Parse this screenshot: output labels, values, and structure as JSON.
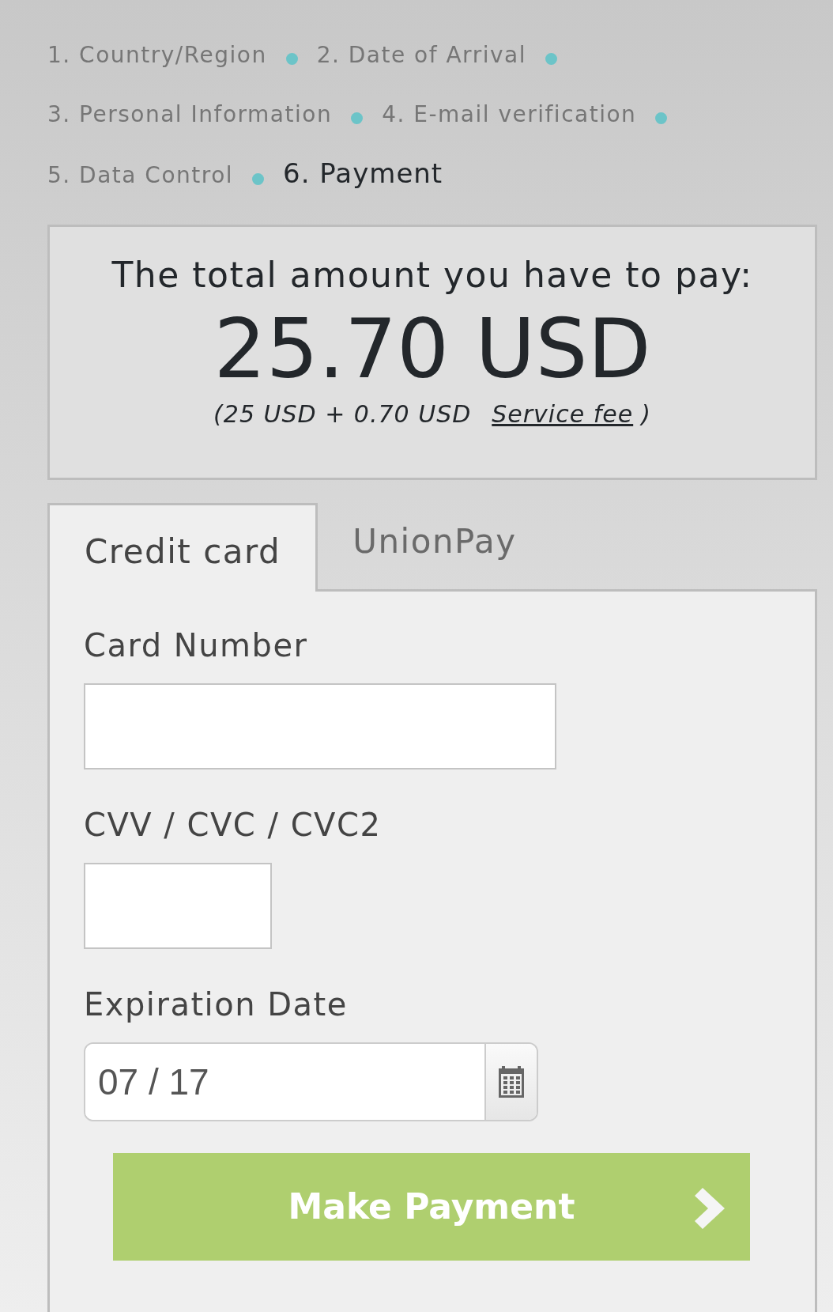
{
  "steps": [
    {
      "label": "1. Country/Region",
      "selected": false
    },
    {
      "label": "2. Date of Arrival",
      "selected": false
    },
    {
      "label": "3. Personal Information",
      "selected": false
    },
    {
      "label": "4. E-mail verification",
      "selected": false
    },
    {
      "label": "5. Data Control",
      "selected": false
    },
    {
      "label": "6. Payment",
      "selected": true
    }
  ],
  "total": {
    "heading": "The total amount you have to pay:",
    "amount": "25.70 USD",
    "breakdown": "(25 USD + 0.70 USD",
    "fee_link": "Service fee",
    "closing": ")"
  },
  "tabs": [
    {
      "label": "Credit card",
      "selected": true
    },
    {
      "label": "UnionPay",
      "selected": false
    }
  ],
  "form": {
    "fields": [
      {
        "kind": "text",
        "label": "Card Number"
      },
      {
        "kind": "short",
        "label": "CVV / CVC / CVC2"
      },
      {
        "kind": "date",
        "label": "Expiration Date",
        "value": "07 / 17"
      }
    ],
    "submit": "Make Payment"
  }
}
